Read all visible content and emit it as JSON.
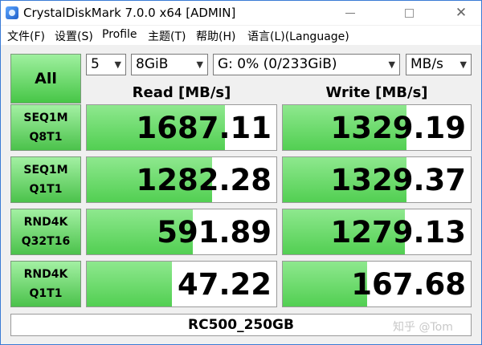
{
  "window": {
    "title": "CrystalDiskMark 7.0.0 x64 [ADMIN]"
  },
  "menu": [
    "文件(F)",
    "设置(S)",
    "Profile",
    "主题(T)",
    "帮助(H)",
    "语言(L)(Language)"
  ],
  "controls": {
    "all_label": "All",
    "count": "5",
    "size": "8GiB",
    "drive": "G: 0% (0/233GiB)",
    "unit": "MB/s"
  },
  "headers": {
    "read": "Read [MB/s]",
    "write": "Write [MB/s]"
  },
  "tests": [
    {
      "line1": "SEQ1M",
      "line2": "Q8T1",
      "read": "1687.11",
      "write": "1329.19",
      "read_fill": 0.73,
      "write_fill": 0.66
    },
    {
      "line1": "SEQ1M",
      "line2": "Q1T1",
      "read": "1282.28",
      "write": "1329.37",
      "read_fill": 0.66,
      "write_fill": 0.66
    },
    {
      "line1": "RND4K",
      "line2": "Q32T16",
      "read": "591.89",
      "write": "1279.13",
      "read_fill": 0.56,
      "write_fill": 0.65
    },
    {
      "line1": "RND4K",
      "line2": "Q1T1",
      "read": "47.22",
      "write": "167.68",
      "read_fill": 0.45,
      "write_fill": 0.45
    }
  ],
  "footer": "RC500_250GB",
  "watermark": "知乎 @Tom",
  "colors": {
    "accent_green": "#52cf52",
    "window_border": "#3a7bd5"
  }
}
